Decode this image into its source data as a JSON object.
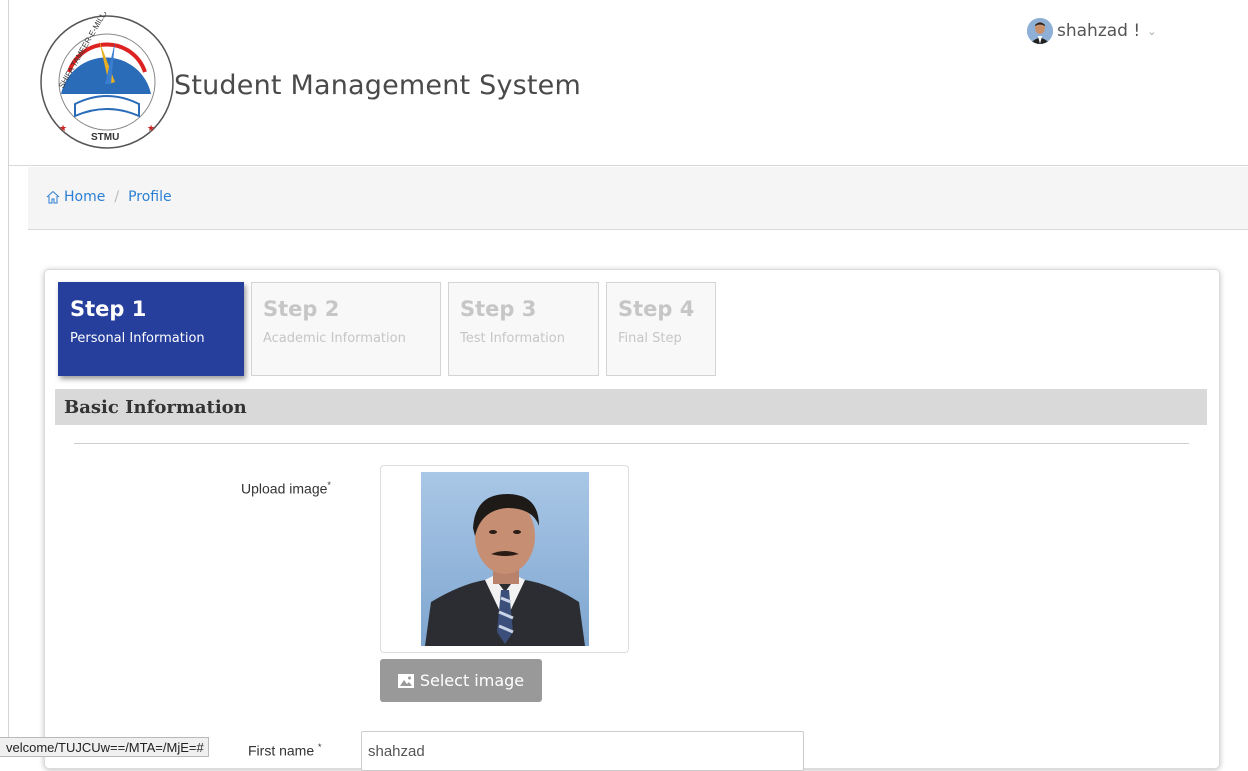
{
  "header": {
    "app_title": "Student Management System",
    "logo_text": "SHIFA TAMEER-E-MILLAT UNIVERSITY",
    "logo_abbr": "STMU",
    "user_name": "shahzad !",
    "caret": "⌄"
  },
  "breadcrumb": {
    "home": "Home",
    "separator": "/",
    "current": "Profile"
  },
  "steps": [
    {
      "title": "Step 1",
      "subtitle": "Personal Information",
      "active": true
    },
    {
      "title": "Step 2",
      "subtitle": "Academic Information",
      "active": false
    },
    {
      "title": "Step 3",
      "subtitle": "Test Information",
      "active": false
    },
    {
      "title": "Step 4",
      "subtitle": "Final Step",
      "active": false
    }
  ],
  "form": {
    "section_title": "Basic Information",
    "upload_label": "Upload image",
    "required_mark": "*",
    "select_image_label": "Select image",
    "first_name_label": "First name",
    "first_name_value": "shahzad"
  },
  "status_bar": {
    "url": "velcome/TUJCUw==/MTA=/MjE=#"
  },
  "colors": {
    "active_step": "#263e9c",
    "link": "#2a7fd4",
    "section_bg": "#d9d9d9",
    "button_bg": "#999999"
  },
  "icons": [
    "home-icon",
    "image-icon",
    "chevron-down-icon",
    "user-avatar"
  ]
}
